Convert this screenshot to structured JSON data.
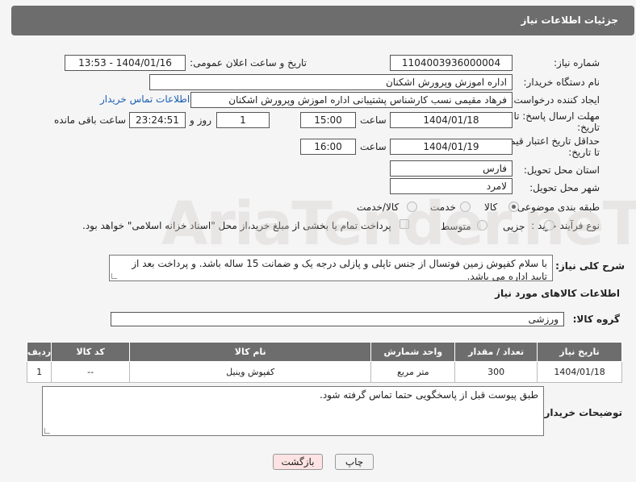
{
  "header": {
    "title": "جزئیات اطلاعات نیاز"
  },
  "fields": {
    "need_number_label": "شماره نیاز:",
    "need_number": "1104003936000004",
    "announce_label": "تاریخ و ساعت اعلان عمومی:",
    "announce_value": "1404/01/16 - 13:53",
    "buyer_org_label": "نام دستگاه خریدار:",
    "buyer_org": "اداره اموزش وپرورش اشکنان",
    "creator_label": "ایجاد کننده درخواست:",
    "creator": "فرهاد مقیمی نسب کارشناس پشتیبانی اداره اموزش وپرورش اشکنان",
    "contact_link": "اطلاعات تماس خریدار",
    "deadline_label_1": "مهلت ارسال پاسخ: تا",
    "deadline_label_2": "تاریخ:",
    "deadline_date": "1404/01/18",
    "time_label": "ساعت",
    "deadline_time": "15:00",
    "days_count": "1",
    "days_label": "روز و",
    "remaining_time": "23:24:51",
    "remaining_label": "ساعت باقی مانده",
    "price_label_1": "حداقل تاریخ اعتبار قیمت:",
    "price_label_2": "تا تاریخ:",
    "price_date": "1404/01/19",
    "price_time": "16:00",
    "province_label": "استان محل تحویل:",
    "province": "فارس",
    "city_label": "شهر محل تحویل:",
    "city": "لامرد",
    "category_label": "طبقه بندی موضوعی:",
    "category_options": [
      "کالا",
      "خدمت",
      "کالا/خدمت"
    ],
    "process_label": "نوع فرآیند خرید :",
    "process_options": [
      "جزیی",
      "متوسط"
    ],
    "payment_note": "پرداخت تمام یا بخشی از مبلغ خرید،از محل \"اسناد خزانه اسلامی\" خواهد بود.",
    "desc_label": "شرح کلی نیاز:",
    "description": "با سلام کفپوش زمین فوتسال از جنس تاپلی و پازلی درجه یک و ضمانت 15 ساله باشد. و پرداخت بعد از تایید اداره می باشد.",
    "goods_info_title": "اطلاعات کالاهای مورد نیاز",
    "goods_group_label": "گروه کالا:",
    "goods_group": "ورزشی"
  },
  "table": {
    "headers": [
      "ردیف",
      "کد کالا",
      "نام کالا",
      "واحد شمارش",
      "تعداد / مقدار",
      "تاریخ نیاز"
    ],
    "rows": [
      [
        "1",
        "--",
        "کفپوش وینیل",
        "متر مربع",
        "300",
        "1404/01/18"
      ]
    ]
  },
  "buyer_notes_label": "توضیحات خریدار:",
  "buyer_notes": "طبق پیوست قبل از پاسخگویی حتما تماس گرفته شود.",
  "buttons": {
    "print": "چاپ",
    "back": "بازگشت"
  },
  "watermark": "AriaTender.neT"
}
